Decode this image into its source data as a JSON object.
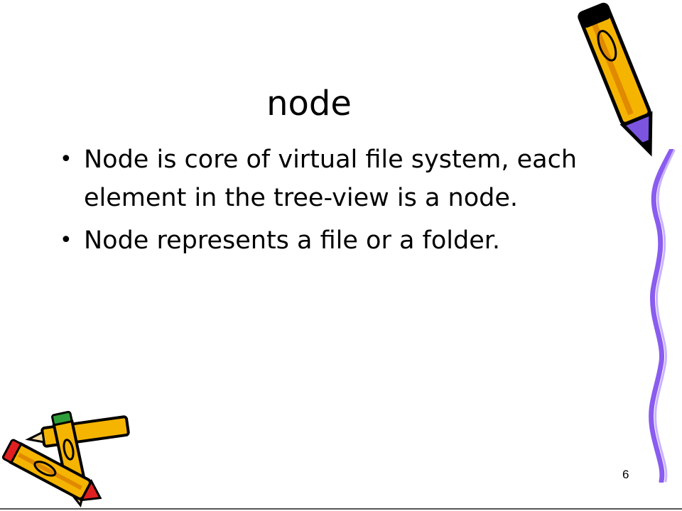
{
  "slide": {
    "title": "node",
    "bullets": [
      {
        "text": "Node is core of virtual file system, each element in the tree-view is a node."
      },
      {
        "text": "Node represents a file or a folder."
      }
    ],
    "bullet_glyph": "•",
    "page_number": "6"
  },
  "decor": {
    "top_right": "pencil-clipart-icon",
    "right_edge": "wavy-ribbon-decoration",
    "bottom_left": "pencils-clipart-icon"
  },
  "colors": {
    "pencil_body": "#F5B400",
    "pencil_stripe": "#E08A00",
    "eraser_purple": "#7B55E0",
    "ribbon_purple": "#8A5CF0",
    "tip_red": "#E02020",
    "tip_green": "#2E9E3A"
  }
}
